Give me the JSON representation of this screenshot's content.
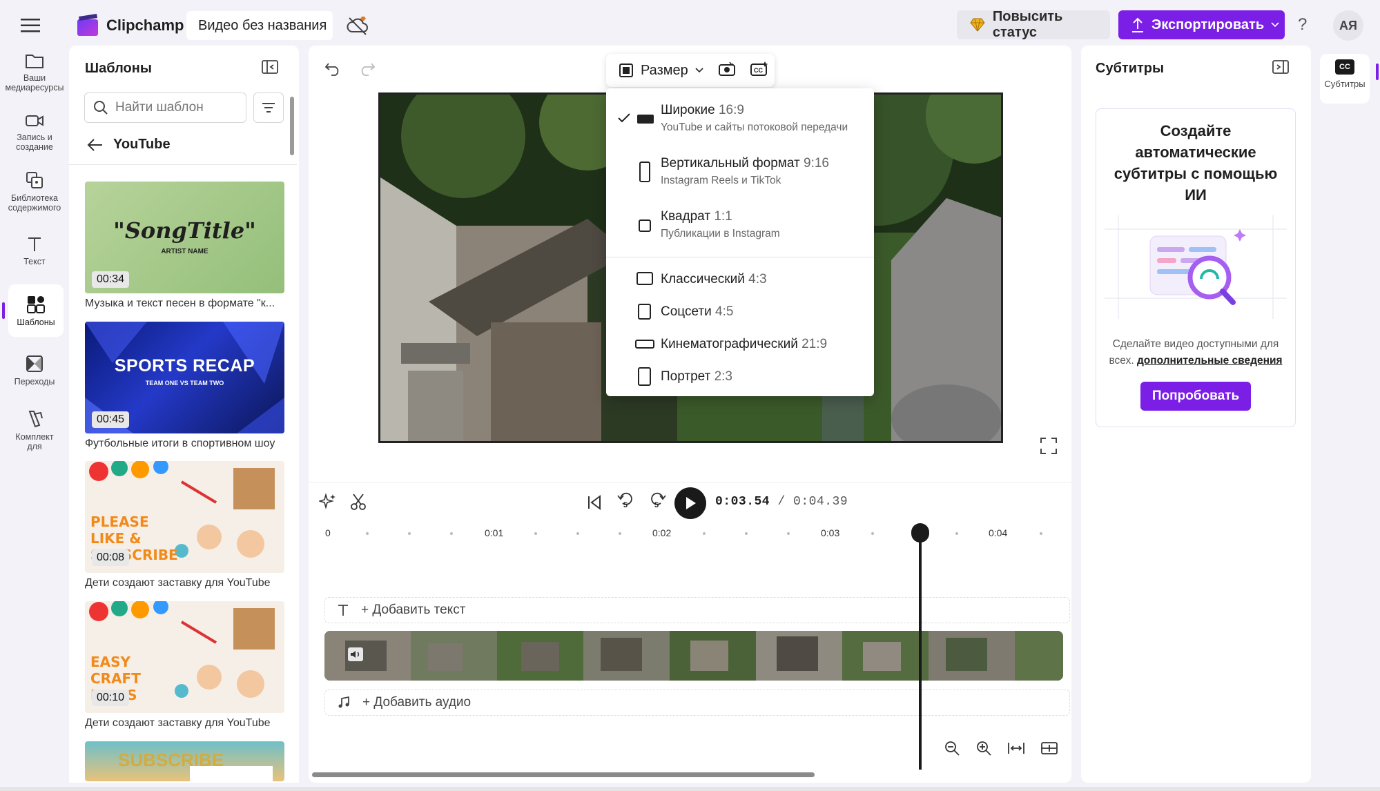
{
  "app": {
    "name": "Clipchamp",
    "project_title": "Видео без названия"
  },
  "header": {
    "upgrade_label": "Повысить статус",
    "export_label": "Экспортировать",
    "help_label": "?",
    "avatar_initials": "АЯ"
  },
  "rail": {
    "items": [
      {
        "label": "Ваши медиаресурсы"
      },
      {
        "label": "Запись и создание"
      },
      {
        "label": "Библиотека содержимого"
      },
      {
        "label": "Текст"
      },
      {
        "label": "Шаблоны"
      },
      {
        "label": "Переходы"
      },
      {
        "label": "Комплект для"
      }
    ],
    "active_index": 4
  },
  "templates": {
    "title": "Шаблоны",
    "search_placeholder": "Найти шаблон",
    "category": "YouTube",
    "cards": [
      {
        "duration": "00:34",
        "caption": "Музыка и текст песен в формате \"к...",
        "thumb_title": "\"SongTitle\"",
        "thumb_sub": "ARTIST NAME"
      },
      {
        "duration": "00:45",
        "caption": "Футбольные итоги в спортивном шоу",
        "thumb_title": "SPORTS RECAP",
        "thumb_sub": "TEAM ONE  VS  TEAM TWO"
      },
      {
        "duration": "00:08",
        "caption": "Дети создают заставку для YouTube",
        "thumb_title": "PLEASE LIKE & SUBSCRIBE"
      },
      {
        "duration": "00:10",
        "caption": "Дети создают заставку для YouTube",
        "thumb_title": "EASY CRAFT IDEAS"
      },
      {
        "thumb_title": "SUBSCRIBE"
      }
    ]
  },
  "editor": {
    "size_label": "Размер",
    "aspect_options": [
      {
        "name": "Широкие",
        "ratio": "16:9",
        "sub": "YouTube и сайты потоковой передачи",
        "checked": true
      },
      {
        "name": "Вертикальный формат",
        "ratio": "9:16",
        "sub": "Instagram Reels и TikTok"
      },
      {
        "name": "Квадрат",
        "ratio": "1:1",
        "sub": "Публикации в Instagram"
      },
      {
        "name": "Классический",
        "ratio": "4:3"
      },
      {
        "name": "Соцсети",
        "ratio": "4:5"
      },
      {
        "name": "Кинематографический",
        "ratio": "21:9"
      },
      {
        "name": "Портрет",
        "ratio": "2:3"
      }
    ]
  },
  "timeline": {
    "current_time": "0:03.54",
    "total_time": "/ 0:04.39",
    "skip_back_label": "5",
    "skip_fwd_label": "5",
    "ruler": [
      "0",
      "0:01",
      "0:02",
      "0:03",
      "0:04"
    ],
    "add_text": "+ Добавить текст",
    "add_audio": "+ Добавить аудио",
    "playhead_seconds": 3.54
  },
  "subtitles": {
    "title": "Субтитры",
    "heading": "Создайте автоматические субтитры с помощью ИИ",
    "desc": "Сделайте видео доступными для всех.",
    "link": "дополнительные сведения",
    "try_label": "Попробовать",
    "rail_label": "Субтитры",
    "rail_icon": "CC"
  },
  "colors": {
    "accent": "#7b1ee6",
    "background": "#f3f2f8"
  }
}
